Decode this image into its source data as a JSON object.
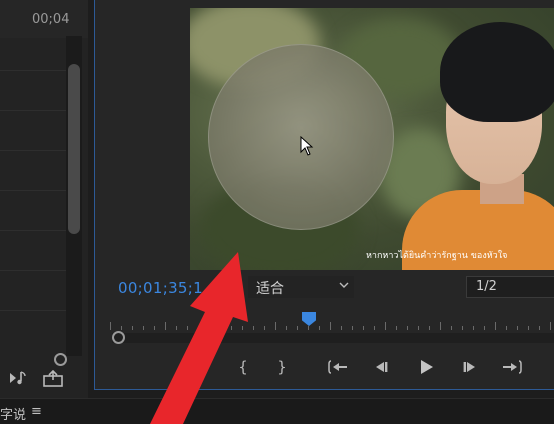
{
  "left_panel": {
    "ruler_timecode": "00;04"
  },
  "monitor": {
    "current_timecode": "00;01;35;1",
    "zoom_select": "适合",
    "resolution_select": "1/2",
    "subtitle_text": "หากหาวได้ยินคำว่ารักฐาน ของหัวใจ"
  },
  "bottom_bar": {
    "panel_label": "字说"
  },
  "icons": {
    "music": "music-note-icon",
    "export": "export-frame-icon",
    "marker": "add-marker-icon",
    "mark_in": "mark-in-icon",
    "mark_out": "mark-out-icon",
    "go_to_in": "go-to-in-icon",
    "step_back": "step-back-icon",
    "play": "play-icon",
    "step_forward": "step-forward-icon",
    "go_to_out": "go-to-out-icon",
    "menu": "hamburger-menu-icon",
    "cursor": "mouse-cursor-icon"
  },
  "colors": {
    "accent_blue": "#3b87e0",
    "annotation_red": "#e8262b",
    "panel_bg": "#262626",
    "shirt_orange": "#e08a35"
  }
}
